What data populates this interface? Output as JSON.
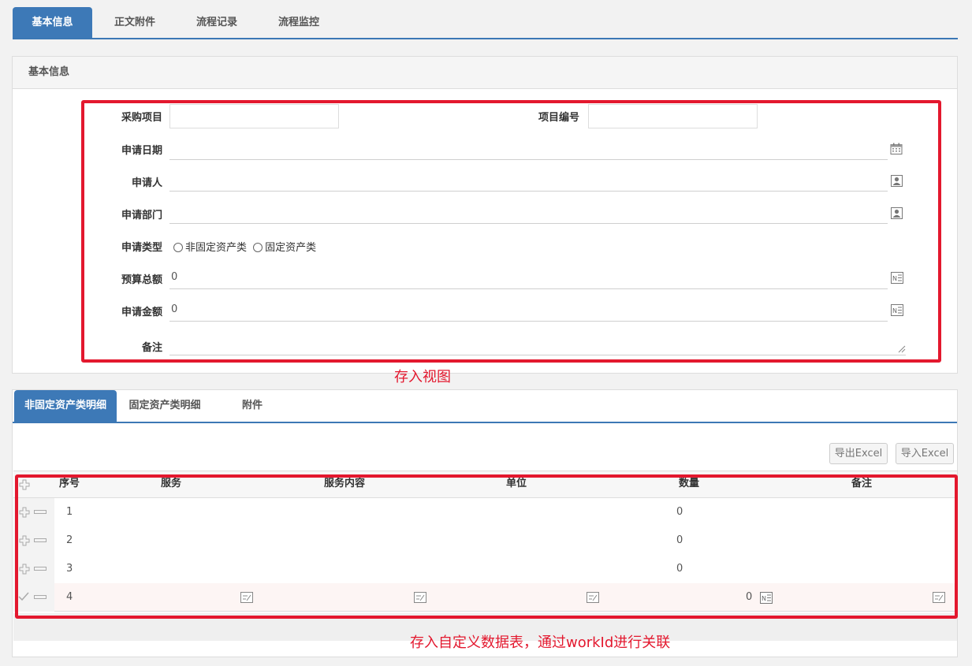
{
  "top_tabs": [
    {
      "label": "基本信息",
      "active": true
    },
    {
      "label": "正文附件",
      "active": false
    },
    {
      "label": "流程记录",
      "active": false
    },
    {
      "label": "流程监控",
      "active": false
    }
  ],
  "basic_panel": {
    "title": "基本信息",
    "fields": {
      "purchase_item": {
        "label": "采购项目",
        "value": ""
      },
      "item_number": {
        "label": "项目编号",
        "value": ""
      },
      "apply_date": {
        "label": "申请日期",
        "value": "",
        "icon": "calendar-icon"
      },
      "applicant": {
        "label": "申请人",
        "value": "",
        "icon": "user-picker-icon"
      },
      "apply_dept": {
        "label": "申请部门",
        "value": "",
        "icon": "user-picker-icon"
      },
      "apply_type": {
        "label": "申请类型",
        "options": [
          "非固定资产类",
          "固定资产类"
        ]
      },
      "budget_total": {
        "label": "预算总额",
        "value": "0",
        "icon": "number-icon"
      },
      "apply_amount": {
        "label": "申请金额",
        "value": "0",
        "icon": "number-icon"
      },
      "remark": {
        "label": "备注",
        "value": ""
      }
    }
  },
  "annotations": {
    "view": "存入视图",
    "table": "存入自定义数据表，通过workId进行关联"
  },
  "detail_panel": {
    "tabs": [
      {
        "label": "非固定资产类明细",
        "active": true
      },
      {
        "label": "固定资产类明细",
        "active": false
      },
      {
        "label": "附件",
        "active": false
      }
    ],
    "export_label": "导出Excel",
    "import_label": "导入Excel",
    "columns": [
      "序号",
      "服务",
      "服务内容",
      "单位",
      "数量",
      "备注"
    ],
    "rows": [
      {
        "index": "1",
        "quantity": "0"
      },
      {
        "index": "2",
        "quantity": "0"
      },
      {
        "index": "3",
        "quantity": "0"
      },
      {
        "index": "4",
        "quantity": "0"
      }
    ]
  },
  "colors": {
    "accent": "#3d79b7",
    "annotation_red": "#e3182e"
  }
}
